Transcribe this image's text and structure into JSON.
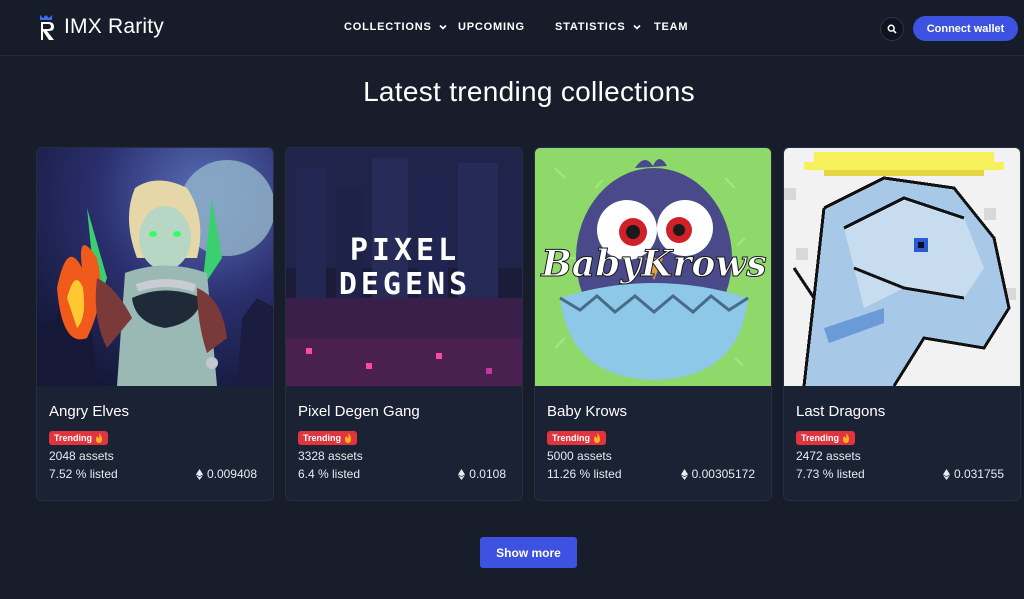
{
  "header": {
    "brand": "IMX Rarity",
    "nav": [
      {
        "label": "COLLECTIONS",
        "has_dropdown": true
      },
      {
        "label": "UPCOMING",
        "has_dropdown": false
      },
      {
        "label": "STATISTICS",
        "has_dropdown": true
      },
      {
        "label": "TEAM",
        "has_dropdown": false
      }
    ],
    "search_icon": "search-icon",
    "connect_label": "Connect wallet"
  },
  "main": {
    "title": "Latest trending collections",
    "cards": [
      {
        "name": "Angry Elves",
        "badge": "Trending",
        "assets": "2048 assets",
        "listed": "7.52 % listed",
        "price": "0.009408"
      },
      {
        "name": "Pixel Degen Gang",
        "badge": "Trending",
        "assets": "3328 assets",
        "listed": "6.4 % listed",
        "price": "0.0108",
        "image_text_line1": "PIXEL",
        "image_text_line2": "DEGENS"
      },
      {
        "name": "Baby Krows",
        "badge": "Trending",
        "assets": "5000 assets",
        "listed": "11.26 % listed",
        "price": "0.00305172",
        "image_text": "BabyKrows"
      },
      {
        "name": "Last Dragons",
        "badge": "Trending",
        "assets": "2472 assets",
        "listed": "7.73 % listed",
        "price": "0.031755"
      }
    ],
    "show_more_label": "Show more"
  },
  "colors": {
    "background": "#171d2b",
    "accent": "#3d52e0",
    "badge": "#e0353f",
    "card": "#1b2233"
  }
}
